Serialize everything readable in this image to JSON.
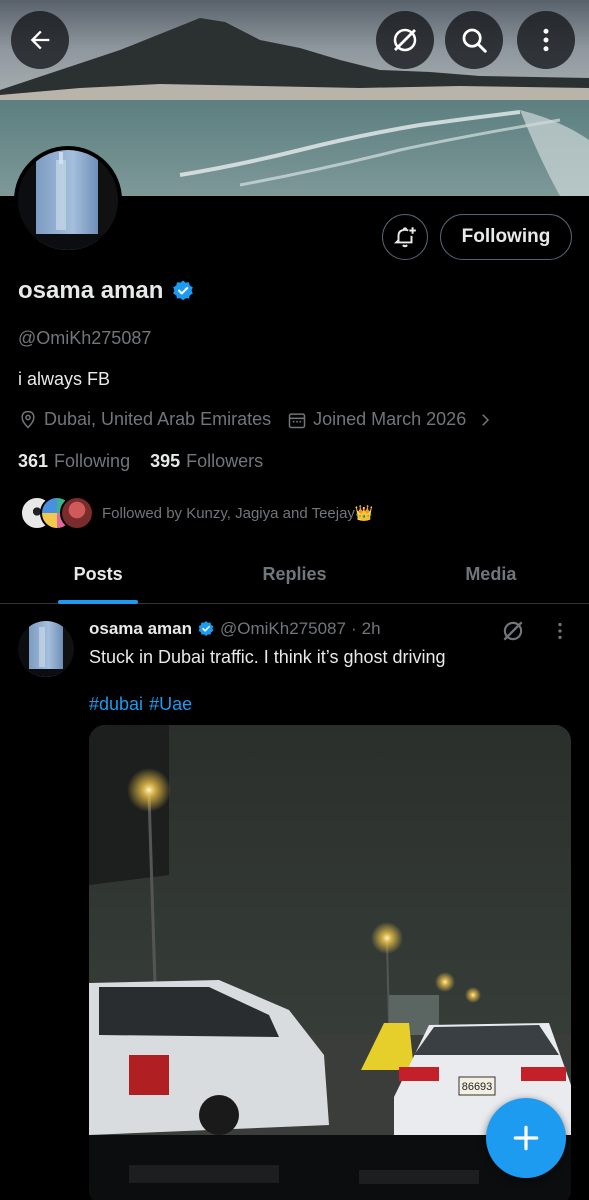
{
  "header": {
    "back_icon": "arrow-left-icon",
    "grok_icon": "grok-icon",
    "search_icon": "search-icon",
    "more_icon": "more-vertical-icon"
  },
  "profile": {
    "name": "osama aman",
    "handle": "@OmiKh275087",
    "bio": "i always FB",
    "location": "Dubai, United Arab Emirates",
    "joined": "Joined March 2026",
    "following_count": "361",
    "following_label": "Following",
    "followers_count": "395",
    "followers_label": "Followers",
    "follow_button_label": "Following",
    "verified_color": "#1d9bf0",
    "followed_by": "Followed by Kunzy, Jagiya and Teejay👑"
  },
  "tabs": [
    {
      "label": "Posts",
      "active": true
    },
    {
      "label": "Replies",
      "active": false
    },
    {
      "label": "Media",
      "active": false
    }
  ],
  "post": {
    "name": "osama aman",
    "handle": "@OmiKh275087",
    "separator": "·",
    "time": "2h",
    "text": "Stuck in Dubai traffic. I think it’s ghost driving",
    "hashtags": [
      "#dubai",
      "#Uae"
    ],
    "plate": "86693"
  },
  "colors": {
    "accent": "#1d9bf0",
    "muted": "#71767b",
    "text": "#e7e9ea",
    "border": "#536471"
  },
  "fab_icon": "plus-icon"
}
